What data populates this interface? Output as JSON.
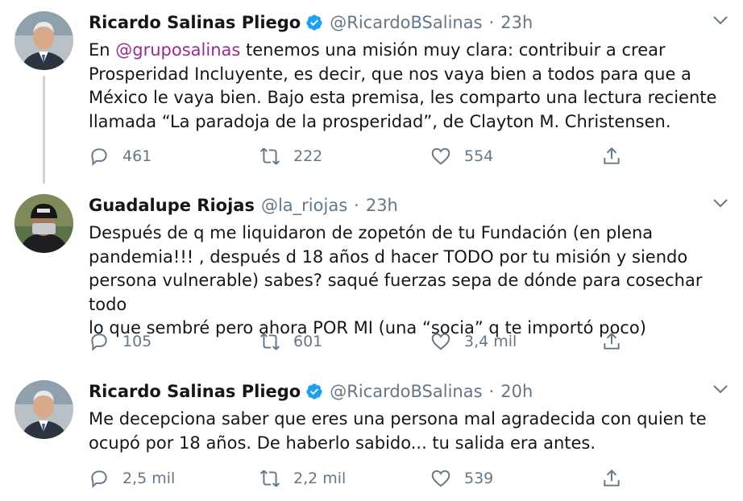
{
  "tweets": [
    {
      "name": "Ricardo Salinas Pliego",
      "verified": true,
      "handle": "@RicardoBSalinas",
      "separator": "·",
      "time": "23h",
      "text_mention": "@gruposalinas",
      "text_before": "En ",
      "text_after": " tenemos una misión muy clara: contribuir a crear\nProsperidad Incluyente, es decir, que nos vaya bien a todos para que a\nMéxico le vaya bien. Bajo esta premisa, les comparto una lectura reciente\nllamada “La paradoja de la prosperidad”, de Clayton M. Christensen.",
      "replies": "461",
      "retweets": "222",
      "likes": "554"
    },
    {
      "name": "Guadalupe Riojas",
      "verified": false,
      "handle": "@la_riojas",
      "separator": "·",
      "time": "23h",
      "text": "Después de q me liquidaron de zopetón de tu Fundación (en plena\npandemia!!! , después d 18 años d hacer TODO por tu misión y siendo\npersona vulnerable) sabes? saqué fuerzas sepa de dónde para cosechar todo\nlo que sembré pero ahora POR MI (una “socia” q te importó poco)",
      "replies": "105",
      "retweets": "601",
      "likes": "3,4 mil"
    },
    {
      "name": "Ricardo Salinas Pliego",
      "verified": true,
      "handle": "@RicardoBSalinas",
      "separator": "·",
      "time": "20h",
      "text": "Me decepciona saber que eres una persona mal agradecida con quien te\nocupó por 18 años. De haberlo sabido... tu salida era antes.",
      "replies": "2,5 mil",
      "retweets": "2,2 mil",
      "likes": "539"
    }
  ],
  "colors": {
    "text": "#14171a",
    "secondary": "#657786",
    "mention": "#9c2b8e",
    "verified": "#1da1f2",
    "thread_line": "#cdd6dd"
  },
  "icons": [
    "reply-icon",
    "retweet-icon",
    "like-icon",
    "share-icon",
    "caret-down-icon",
    "verified-badge-icon"
  ]
}
